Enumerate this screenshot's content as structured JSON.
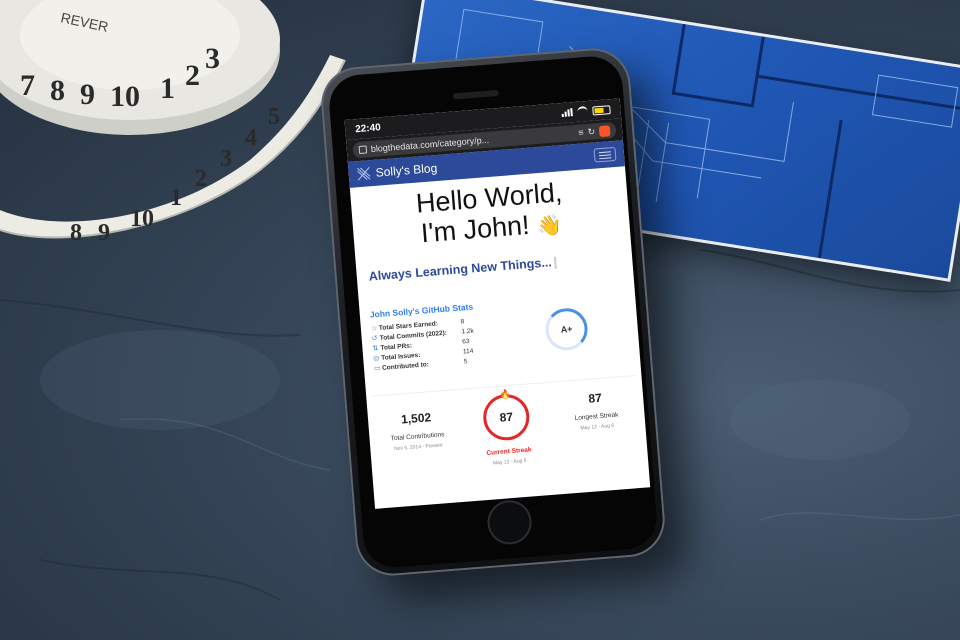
{
  "scene": {
    "tape_numbers": [
      "7",
      "8",
      "9",
      "10",
      "1",
      "2",
      "3",
      "4",
      "5"
    ],
    "tape_text": "REVER"
  },
  "phone": {
    "status": {
      "time": "22:40"
    },
    "browser": {
      "url": "blogthedata.com/category/p..."
    },
    "navbar": {
      "brand": "Solly's Blog"
    },
    "hero": {
      "title_line1": "Hello World,",
      "title_line2": "I'm John!",
      "wave": "👋",
      "tagline": "Always Learning New Things..."
    },
    "github_stats": {
      "title": "John Solly's GitHub Stats",
      "rows": [
        {
          "icon": "☆",
          "label": "Total Stars Earned:",
          "value": "8"
        },
        {
          "icon": "↺",
          "label": "Total Commits (2022):",
          "value": "1.2k"
        },
        {
          "icon": "⇅",
          "label": "Total PRs:",
          "value": "63"
        },
        {
          "icon": "◎",
          "label": "Total Issues:",
          "value": "114"
        },
        {
          "icon": "▭",
          "label": "Contributed to:",
          "value": "5"
        }
      ],
      "grade": "A+"
    },
    "streak": {
      "total": {
        "value": "1,502",
        "label": "Total Contributions",
        "range": "Nov 5, 2014 - Present"
      },
      "current": {
        "value": "87",
        "label": "Current Streak",
        "range": "May 12 - Aug 6"
      },
      "longest": {
        "value": "87",
        "label": "Longest Streak",
        "range": "May 12 - Aug 6"
      }
    }
  }
}
